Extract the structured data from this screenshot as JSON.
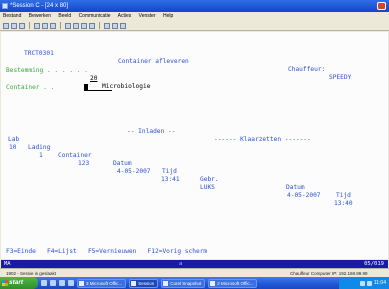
{
  "window": {
    "title": "*Session C - [24 x 80]"
  },
  "menu": [
    "Bestand",
    "Bewerken",
    "Beeld",
    "Communicatie",
    "Acties",
    "Venster",
    "Help"
  ],
  "terminal": {
    "program_id": "TRCT0301",
    "screen_title": "Container afleveren",
    "driver_label": "Chauffeur:",
    "driver_value": "SPEEDY",
    "destination_label": "Bestemming . . . . . .",
    "destination_code": "20",
    "destination_name": "Microbiologie",
    "container_label": "Container . .",
    "group_inladen": "-- Inladen --",
    "group_klaarzetten": "------ Klaarzetten -------",
    "columns": {
      "lab": "Lab",
      "lading": "Lading",
      "container": "Container",
      "datum1": "Datum",
      "tijd1": "Tijd",
      "gebr": "Gebr.",
      "datum2": "Datum",
      "tijd2": "Tijd"
    },
    "rows": [
      {
        "lab": "10",
        "lading": "1",
        "container": "123",
        "datum1": "4-05-2007",
        "tijd1": "13:41",
        "gebr": "LUKS",
        "datum2": "4-05-2007",
        "tijd2": "13:40"
      }
    ],
    "function_keys": "F3=Einde   F4=Lijst   F5=Vernieuwen   F12=Vorig scherm"
  },
  "status_bar": {
    "session": "MA",
    "indicator": "a",
    "cursor_pos": "05/019"
  },
  "info_bar": {
    "left": "1902 - Sessie is geslaakt",
    "right": "Chauffeur Computer IP: 192.168.99.99"
  },
  "taskbar": {
    "start_label": "start",
    "tasks": [
      "3 Microsoft Offic...",
      "Session",
      "Corel Snapshot",
      "2 Microsoft Offic..."
    ],
    "clock": "11:04"
  }
}
